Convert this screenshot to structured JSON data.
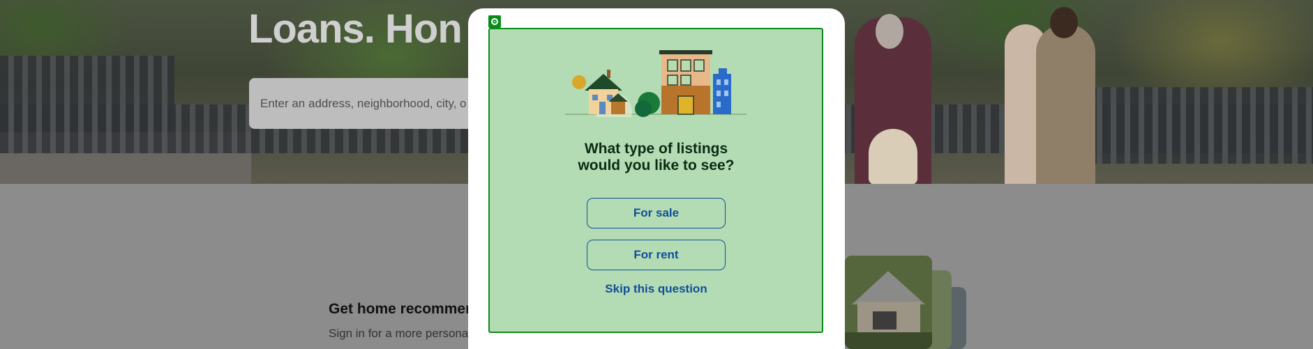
{
  "background": {
    "hero_title": "Loans. Hon",
    "search_placeholder": "Enter an address, neighborhood, city, o",
    "recommendations_title": "Get home recommen",
    "recommendations_subtitle": "Sign in for a more persona"
  },
  "modal": {
    "question_line1": "What type of listings",
    "question_line2": "would you like to see?",
    "options": [
      "For sale",
      "For rent"
    ],
    "skip_label": "Skip this question"
  },
  "colors": {
    "panel_bg": "#b4dcb4",
    "panel_border": "#0a8a18",
    "button_text": "#0f4e9a",
    "question_text": "#0b2a12"
  }
}
